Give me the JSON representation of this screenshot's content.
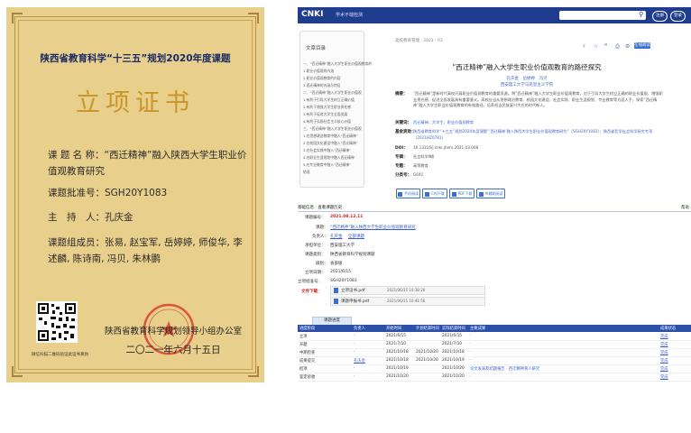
{
  "certificate": {
    "heading": "陕西省教育科学“十三五”规划2020年度课题",
    "title": "立项证书",
    "topic_label": "课 题 名 称：",
    "topic_value": "“西迁精神”融入陕西大学生职业价值观教育研究",
    "approval_label": "课题批准号：",
    "approval_value": "SGH20Y1083",
    "host_label": "主　持　人：",
    "host_value": "孔庆金",
    "members_label": "课题组成员：",
    "members_value": "张易, 赵宝军, 岳婷婷, 师俊华, 李述麟, 陈诗南, 冯贝, 朱林鹏",
    "issuer_line1": "陕西省教育科学规划领导小组办公室",
    "issuer_line2": "二〇二一年六月十五日",
    "qr_caption": "微信扫描二维码验证此证书真伪"
  },
  "portal": {
    "logo": "CNKI",
    "logo_sub": "学术不端检测",
    "topbar_buttons": [
      "注册",
      "登录"
    ],
    "outline_title": "文章目录",
    "outline_items": [
      "一、“西迁精神”融入大学生职业价值观教育的",
      "1.职业价值观的内涵",
      "2.职业价值观教育的内容",
      "3.西迁精神的内涵与特征",
      "二、“西迁精神”融入大学生职业价值观",
      "1.有利于引导大学生树立正确价值",
      "2.有利于增强大学生职业责任感",
      "3.有利于促进大学生全面发展",
      "4.有利于弘扬社会主义核心价值",
      "三、“西迁精神”融入大学生职业价值观",
      "1.在思想政治教育中融入“西迁精神”",
      "2.在校园文化建设中融入“西迁精神”",
      "3.在社会实践中融入“西迁精神”",
      "4.在职业生涯规划中融入西迁精神",
      "5.在专业教育中融入“西迁精神”",
      "结语"
    ],
    "breadcrumb": "高校教育管理 · 2021 · 03",
    "tool_button": "在线阅读",
    "paper_title": "“西迁精神”融入大学生职业价值观教育的路径探究",
    "authors": "孔庆金　岳婷婷　冯贝",
    "affiliation": "西安理工大学马克思主义学院",
    "meta": [
      {
        "label": "摘要：",
        "value": "“西迁精神”是新时代高校开展职业价值观教育的重要资源。将“西迁精神”融入大学生职业价值观教育，对于引导大学生树立正确的职业价值观、增强职业责任感、促进全面发展具有重要意义。高校应当从思想政治教育、校园文化建设、社会实践、职业生涯规划、专业教育等方面入手，探索“西迁精神”融入大学生职业价值观教育的有效路径，培养担当民族复兴大任的时代新人。",
        "blue": false
      },
      {
        "label": "关键词：",
        "value": "西迁精神；大学生；职业价值观教育",
        "blue": true
      },
      {
        "label": "基金资助：",
        "value": "陕西省教育科学“十三五”规划2020年度课题“‘西迁精神’融入陕西大学生职业价值观教育研究”（SGH20Y1083）；陕西省哲学社会科学研究专项（2021HZ0781）",
        "blue": true
      },
      {
        "label": "DOI：",
        "value": "10.13316/j.cnki.jhem.2021.03.008",
        "blue": false
      },
      {
        "label": "专辑：",
        "value": "社会科学Ⅱ辑",
        "blue": false
      },
      {
        "label": "专题：",
        "value": "高等教育",
        "blue": false
      },
      {
        "label": "分类号：",
        "value": "G641",
        "blue": false
      }
    ],
    "download_buttons": [
      "手机阅读",
      "CAJ下载",
      "PDF下载",
      "AI辅助阅读"
    ],
    "section_tab": "基础信息 · 查看课题历史",
    "help_text": "帮助",
    "form": {
      "project_no_label": "课题编号：",
      "project_no_value": "2021.08.12.11",
      "topic_label": "课题：",
      "topic_value": "“西迁精神”融入陕西大学生职业价值观教育研究",
      "host_label": "负责人：",
      "host_value": "孔庆金",
      "host_extra": "全部课题",
      "unit_label": "承担单位：",
      "unit_value": "西安理工大学",
      "category_label": "课题类别：",
      "category_value": "陕西省教育科学规划课题",
      "level_label": "级别：",
      "level_value": "省部级",
      "date_label": "立项日期：",
      "date_value": "2021/6/15",
      "remark_label": "立项批准号：",
      "remark_value": "SGH20Y1083",
      "attach_label": "文件下载：",
      "attachments": [
        {
          "name": "立项证书.pdf",
          "date": "2021/06/15 10:38:20"
        },
        {
          "name": "课题申报书.pdf",
          "date": "2021/06/15 10:41:56"
        }
      ]
    },
    "table_tab": "课题进度",
    "table_headers": [
      "进度阶段",
      "负责人",
      "开始时间",
      "计划结束时间",
      "实际结束时间",
      "主要成果",
      "成果状态"
    ],
    "table_rows": [
      [
        "立项",
        "·",
        "2021/6/15",
        "",
        "2021/6/15",
        "·",
        "完成"
      ],
      [
        "开题",
        "·",
        "2021/7/10",
        "",
        "2021/7/10",
        "·",
        "完成"
      ],
      [
        "中期检查",
        "·",
        "2021/10/18",
        "2021/10/20",
        "2021/10/18",
        "·",
        "完成"
      ],
      [
        "成果提交",
        "孔庆金",
        "2021/10/18",
        "2021/10/20",
        "2021/10/19",
        "·",
        "完成"
      ],
      [
        "结项",
        "·",
        "2021/10/19",
        "",
        "2021/10/20",
        "论文发表及结题报告 · 西迁精神育人研究",
        "完成"
      ],
      [
        "鉴定验收",
        "·",
        "2021/10/20",
        "",
        "2021/10/20",
        "·",
        "完成"
      ]
    ]
  }
}
